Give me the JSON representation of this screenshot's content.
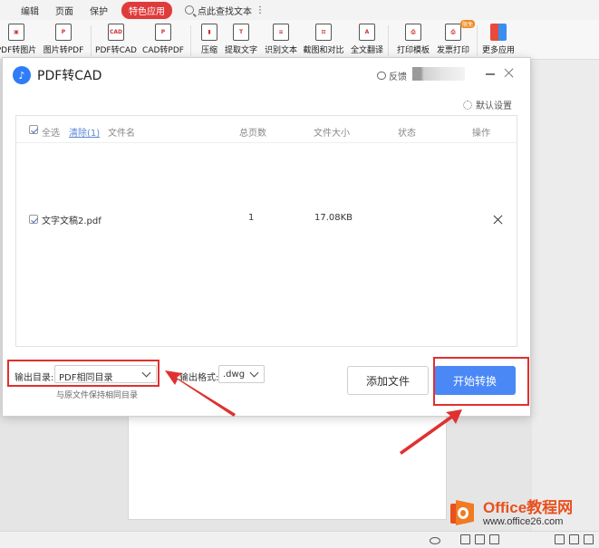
{
  "menubar": {
    "items": [
      "编辑",
      "页面",
      "保护"
    ],
    "active": "特色应用",
    "search_placeholder": "点此查找文本",
    "more": "⋮"
  },
  "toolbar": {
    "tools": [
      {
        "label": "PDF转图片",
        "icon": "pdf-to-image-icon"
      },
      {
        "label": "图片转PDF",
        "icon": "image-to-pdf-icon"
      },
      {
        "label": "PDF转CAD",
        "icon": "pdf-to-cad-icon"
      },
      {
        "label": "CAD转PDF",
        "icon": "cad-to-pdf-icon"
      },
      {
        "label": "压缩",
        "icon": "compress-icon"
      },
      {
        "label": "提取文字",
        "icon": "extract-text-icon"
      },
      {
        "label": "识别文本",
        "icon": "recognize-text-icon"
      },
      {
        "label": "截图和对比",
        "icon": "screenshot-compare-icon"
      },
      {
        "label": "全文翻译",
        "icon": "translate-icon"
      },
      {
        "label": "打印模板",
        "icon": "print-template-icon"
      },
      {
        "label": "发票打印",
        "icon": "invoice-print-icon",
        "badge": "限免"
      },
      {
        "label": "更多应用",
        "icon": "more-apps-icon"
      }
    ]
  },
  "dialog": {
    "title": "PDF转CAD",
    "feedback": "反馈",
    "default_settings": "默认设置",
    "table": {
      "select_all": "全选",
      "clear": "清除(1)",
      "headers": {
        "name": "文件名",
        "pages": "总页数",
        "size": "文件大小",
        "status": "状态",
        "action": "操作"
      },
      "rows": [
        {
          "name": "文字文稿2.pdf",
          "pages": "1",
          "size": "17.08KB",
          "status": ""
        }
      ]
    },
    "output_dir_label": "输出目录:",
    "output_dir_value": "PDF相同目录",
    "output_dir_hint": "与原文件保持相同目录",
    "output_format_label": "输出格式:",
    "output_format_value": ".dwg",
    "add_file": "添加文件",
    "start": "开始转换"
  },
  "watermark": {
    "title": "Office教程网",
    "url": "www.office26.com"
  },
  "colors": {
    "accent": "#4a88f5",
    "highlight": "#e03030",
    "active_tab": "#e03b3b"
  }
}
